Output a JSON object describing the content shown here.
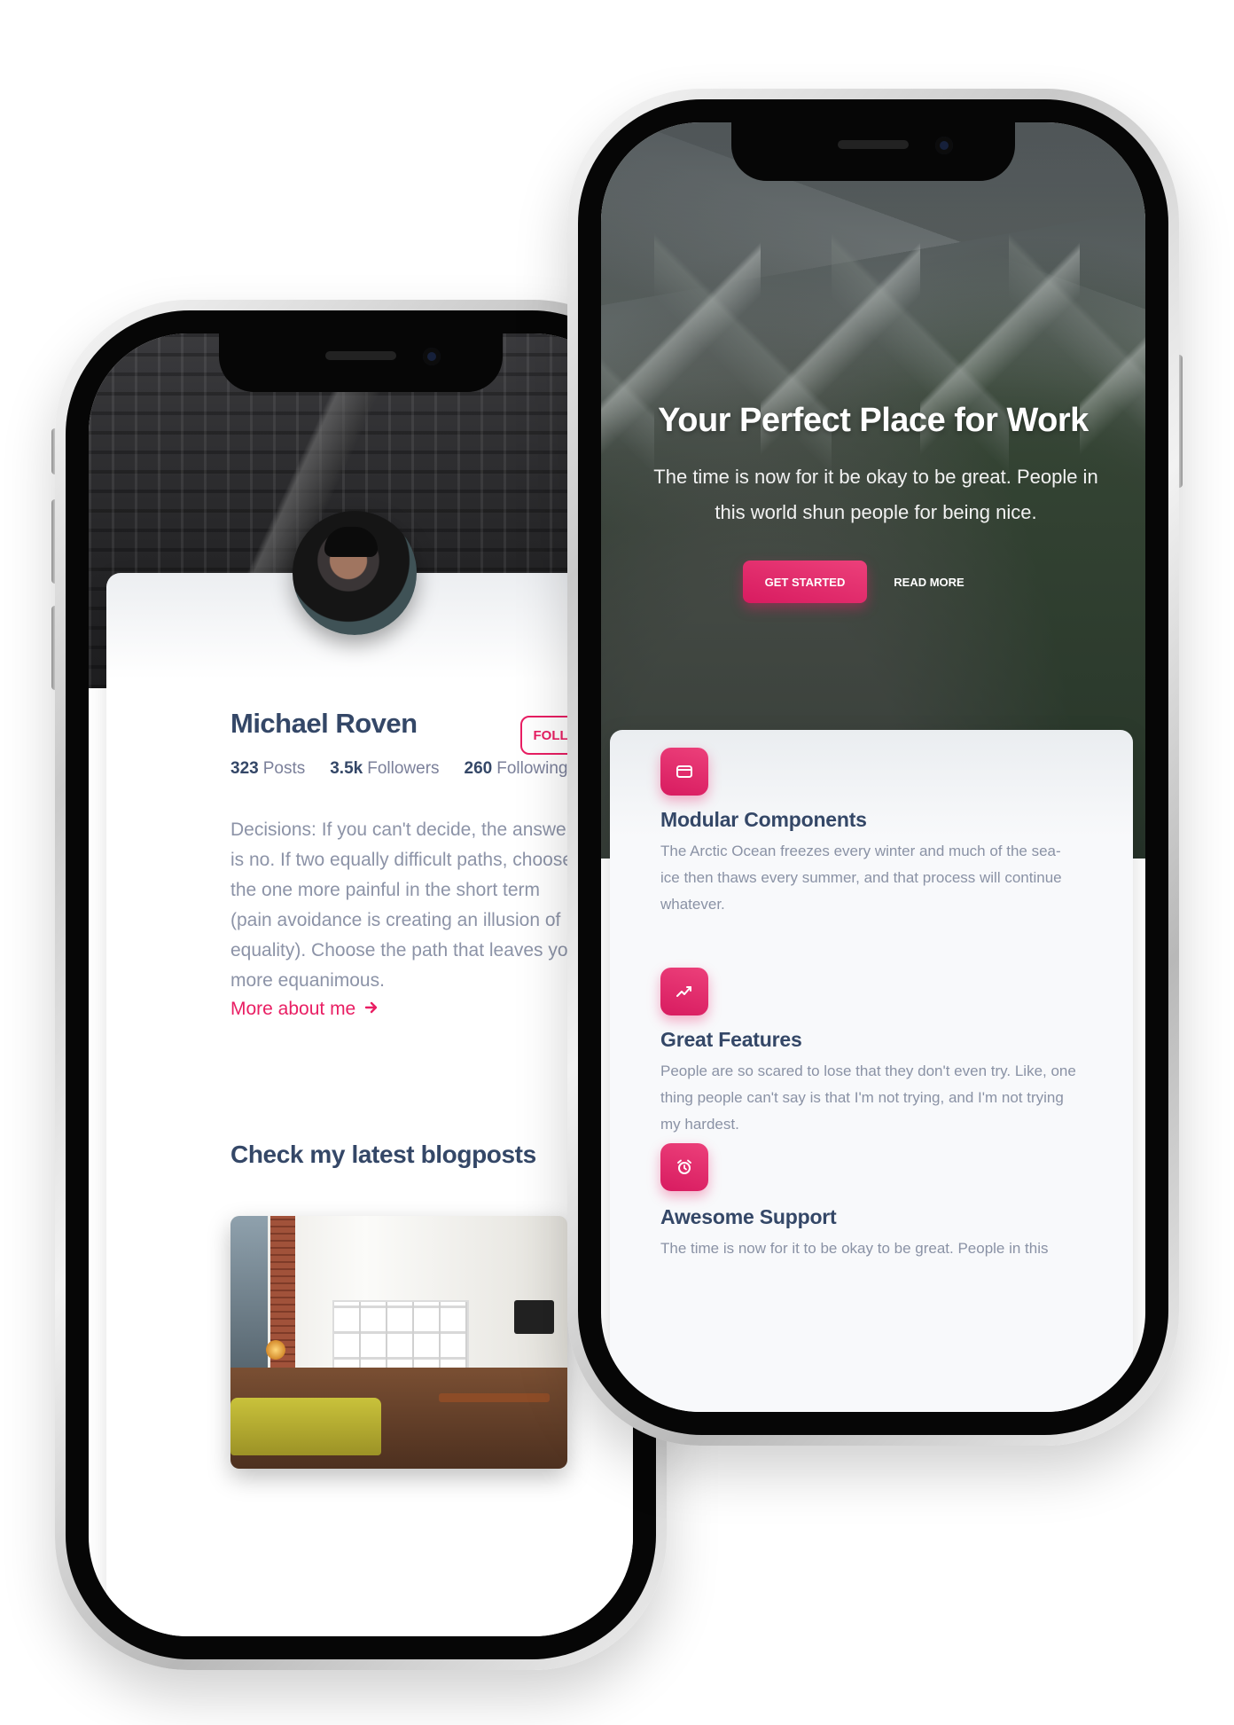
{
  "profile_screen": {
    "name": "Michael Roven",
    "follow_label": "FOLLOW",
    "stats": [
      {
        "value": "323",
        "label": "Posts"
      },
      {
        "value": "3.5k",
        "label": "Followers"
      },
      {
        "value": "260",
        "label": "Following"
      }
    ],
    "bio": "Decisions: If you can't decide, the answer is no. If two equally difficult paths, choose the one more painful in the short term (pain avoidance is creating an illusion of equality). Choose the path that leaves you more equanimous.",
    "more_link": "More about me",
    "blog_heading": "Check my latest blogposts"
  },
  "landing_screen": {
    "hero_title": "Your Perfect Place for Work",
    "hero_text": "The time is now for it be okay to be great. People in this world shun people for being nice.",
    "primary_button": "GET STARTED",
    "secondary_button": "READ MORE",
    "features": [
      {
        "icon": "credit-card-icon",
        "title": "Modular Components",
        "text": "The Arctic Ocean freezes every winter and much of the sea-ice then thaws every summer, and that process will continue whatever."
      },
      {
        "icon": "chart-line-icon",
        "title": "Great Features",
        "text": "People are so scared to lose that they don't even try. Like, one thing people can't say is that I'm not trying, and I'm not trying my hardest."
      },
      {
        "icon": "alarm-clock-icon",
        "title": "Awesome Support",
        "text": "The time is now for it to be okay to be great. People in this"
      }
    ]
  },
  "colors": {
    "accent": "#e91e63",
    "heading": "#344767",
    "muted": "#7b809a"
  }
}
